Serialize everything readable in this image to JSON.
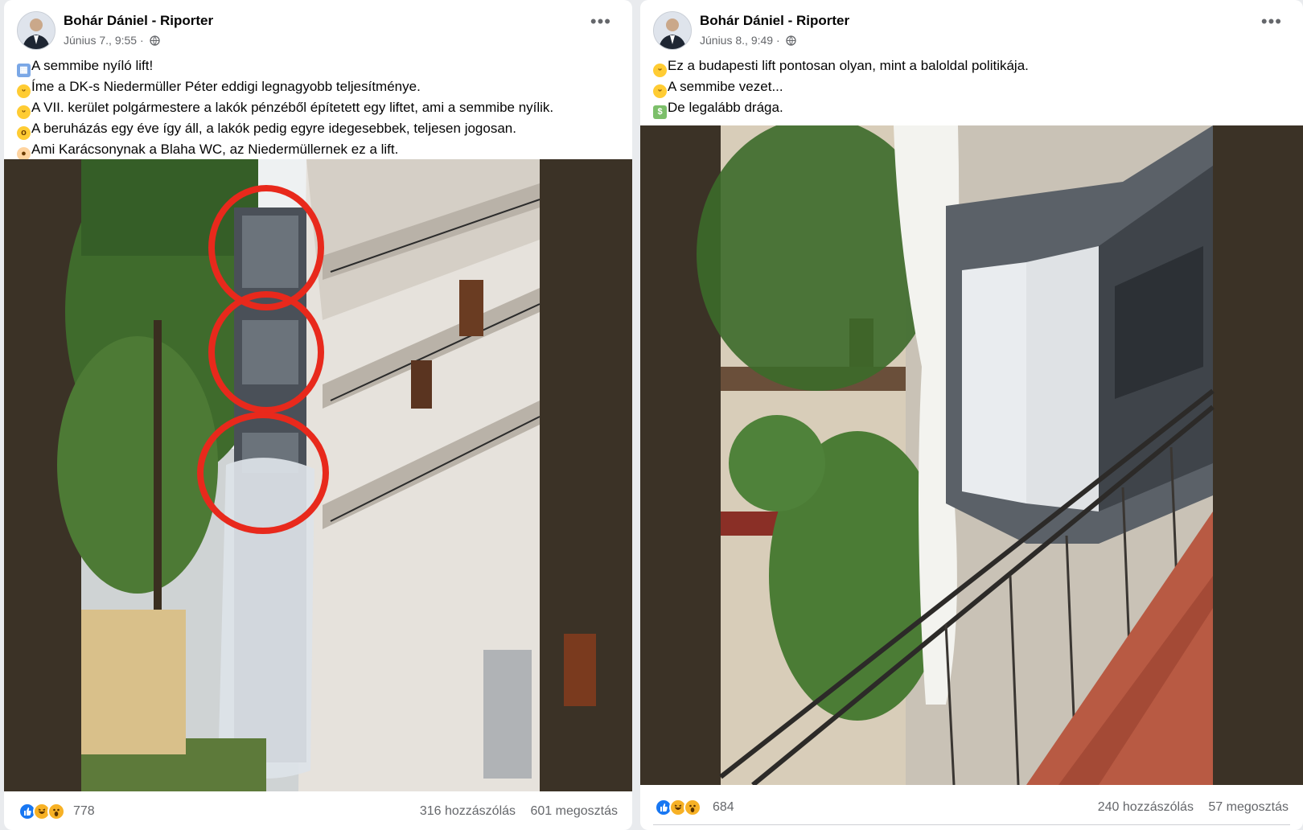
{
  "posts": [
    {
      "author": "Bohár Dániel - Riporter",
      "timestamp": "Június 7., 9:55 ·",
      "audience_icon": "globe-icon",
      "lines": [
        {
          "emoji": "calendar",
          "text": "A semmibe nyíló lift!"
        },
        {
          "emoji": "grin",
          "text": "Íme a DK-s Niedermüller Péter eddigi legnagyobb teljesítménye."
        },
        {
          "emoji": "wink",
          "text": "A VII. kerület polgármestere a lakók pénzéből építetett egy liftet, ami a semmibe nyílik."
        },
        {
          "emoji": "screaming",
          "text": "A beruházás egy éve így áll, a lakók pedig egyre idegesebbek, teljesen jogosan."
        },
        {
          "emoji": "clown",
          "text": "Ami Karácsonynak a Blaha WC, az Niedermüllernek ez a lift."
        }
      ],
      "reactions": {
        "icons": [
          "like-icon",
          "haha-icon",
          "wow-icon"
        ],
        "count": "778"
      },
      "comments": "316 hozzászólás",
      "shares": "601 megosztás"
    },
    {
      "author": "Bohár Dániel - Riporter",
      "timestamp": "Június 8., 9:49 ·",
      "audience_icon": "globe-icon",
      "lines": [
        {
          "emoji": "grin",
          "text": "Ez a budapesti lift pontosan olyan, mint a baloldal politikája."
        },
        {
          "emoji": "joy",
          "text": "A semmibe vezet..."
        },
        {
          "emoji": "money",
          "text": "De legalább drága."
        }
      ],
      "reactions": {
        "icons": [
          "like-icon",
          "haha-icon",
          "wow-icon"
        ],
        "count": "684"
      },
      "comments": "240 hozzászólás",
      "shares": "57 megosztás"
    }
  ],
  "colors": {
    "accent_like": "#1877f2",
    "reaction_yellow": "#f7b125",
    "highlight_circle": "#e8291c",
    "photo_background": "#3b3226"
  }
}
